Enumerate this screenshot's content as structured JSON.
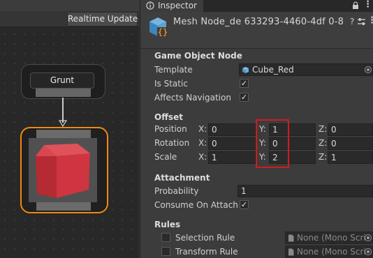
{
  "graph": {
    "toolbar_button": "Realtime Update",
    "nodes": [
      {
        "label": "Grunt"
      }
    ]
  },
  "inspector": {
    "tab_title": "Inspector",
    "object_name": "Mesh Node_de 633293-4460-4df 0-8",
    "sections": {
      "game_object_node": "Game Object Node",
      "offset": "Offset",
      "attachment": "Attachment",
      "rules": "Rules"
    },
    "template": {
      "label": "Template",
      "value": "Cube_Red"
    },
    "is_static": {
      "label": "Is Static",
      "checked": true
    },
    "affects_navigation": {
      "label": "Affects Navigation",
      "checked": true
    },
    "offset": {
      "position": {
        "label": "Position",
        "x": "0",
        "y": "1",
        "z": "0"
      },
      "rotation": {
        "label": "Rotation",
        "x": "0",
        "y": "0",
        "z": "0"
      },
      "scale": {
        "label": "Scale",
        "x": "1",
        "y": "2",
        "z": "1"
      },
      "axis_labels": {
        "x": "X:",
        "y": "Y:",
        "z": "Z:"
      }
    },
    "probability": {
      "label": "Probability",
      "value": "1"
    },
    "consume_on_attach": {
      "label": "Consume On Attach",
      "checked": true
    },
    "selection_rule": {
      "label": "Selection Rule",
      "value": "None (Mono Scri",
      "checked": false
    },
    "transform_rule": {
      "label": "Transform Rule",
      "value": "None (Mono Scri",
      "checked": false
    }
  },
  "colors": {
    "selected_node_outline": "#ee8a12",
    "highlight_box": "#d21c1c",
    "cube": "#c8323c"
  }
}
